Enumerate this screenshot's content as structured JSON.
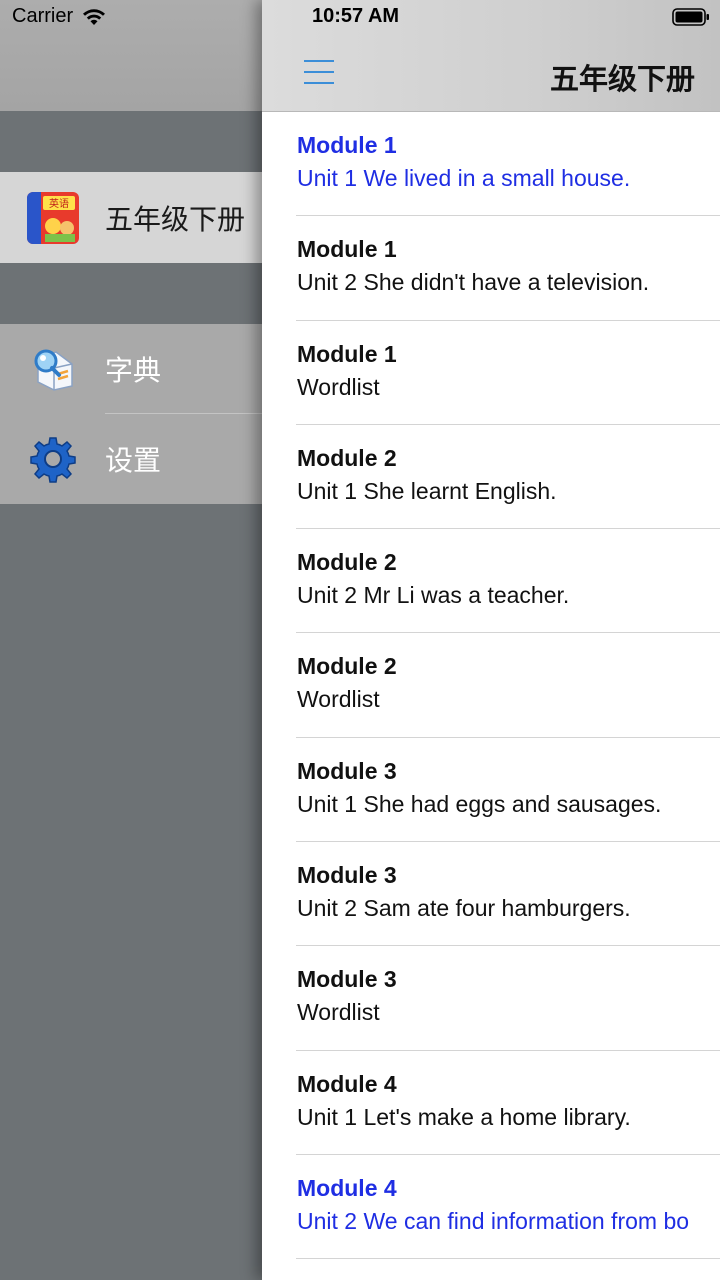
{
  "status_bar": {
    "carrier": "Carrier",
    "time": "10:57 AM",
    "icons": [
      "wifi-icon",
      "battery-icon"
    ]
  },
  "drawer": {
    "book": {
      "icon": "english-textbook-icon",
      "label": "五年级下册"
    },
    "menu": [
      {
        "icon": "dictionary-search-icon",
        "label": "字典"
      },
      {
        "icon": "gear-icon",
        "label": "设置"
      }
    ]
  },
  "navbar": {
    "menu_icon": "hamburger-menu-icon",
    "title": "五年级下册"
  },
  "lessons": [
    {
      "module": "Module 1",
      "unit": "Unit 1 We lived in a small house.",
      "highlight": true
    },
    {
      "module": "Module 1",
      "unit": "Unit 2 She didn't have a television.",
      "highlight": false
    },
    {
      "module": "Module 1",
      "unit": "Wordlist",
      "highlight": false
    },
    {
      "module": "Module 2",
      "unit": "Unit 1 She learnt English.",
      "highlight": false
    },
    {
      "module": "Module 2",
      "unit": "Unit 2 Mr Li was a teacher.",
      "highlight": false
    },
    {
      "module": "Module 2",
      "unit": "Wordlist",
      "highlight": false
    },
    {
      "module": "Module 3",
      "unit": "Unit 1 She had eggs and sausages.",
      "highlight": false
    },
    {
      "module": "Module 3",
      "unit": "Unit 2 Sam ate four hamburgers.",
      "highlight": false
    },
    {
      "module": "Module 3",
      "unit": "Wordlist",
      "highlight": false
    },
    {
      "module": "Module 4",
      "unit": "Unit 1 Let's make a home library.",
      "highlight": false
    },
    {
      "module": "Module 4",
      "unit": "Unit 2 We can find information from bo",
      "highlight": true
    }
  ],
  "colors": {
    "highlight_text": "#1f2ee3",
    "menu_icon": "#3b8ed8",
    "drawer_bg": "#6d7275",
    "selected_row_bg": "#d6d6d6"
  }
}
